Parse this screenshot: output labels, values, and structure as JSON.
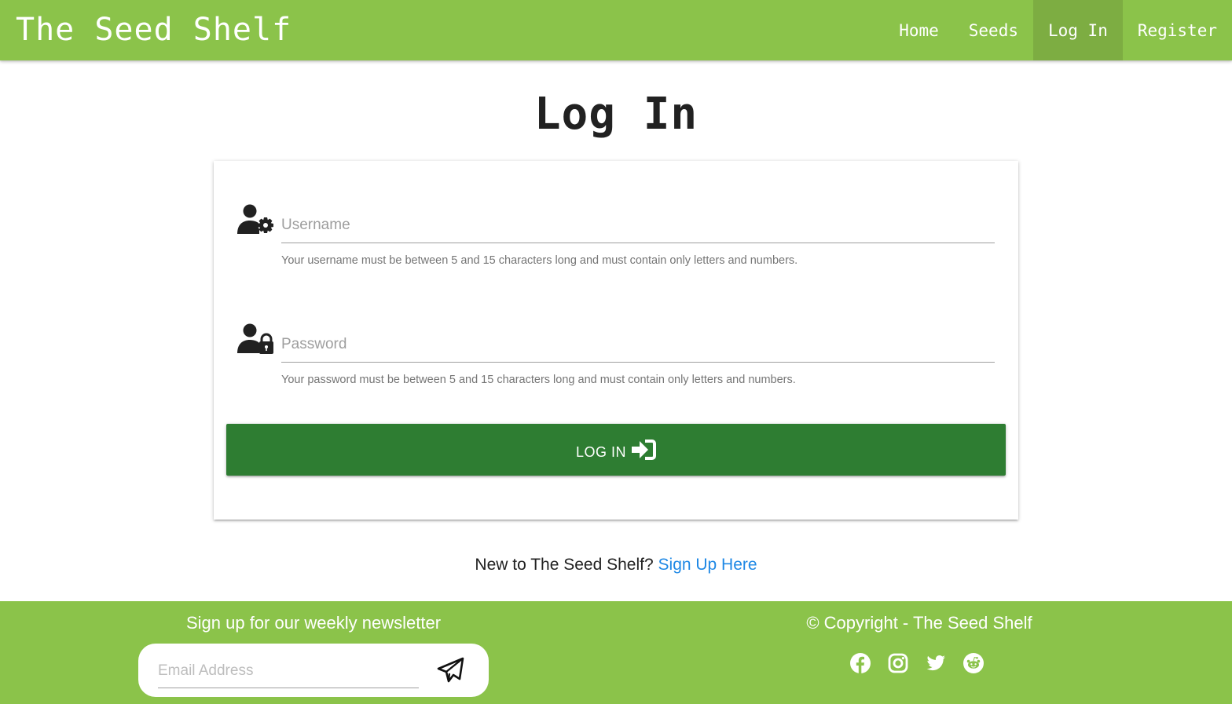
{
  "navbar": {
    "brand": "The Seed Shelf",
    "items": [
      {
        "label": "Home",
        "active": false
      },
      {
        "label": "Seeds",
        "active": false
      },
      {
        "label": "Log In",
        "active": true
      },
      {
        "label": "Register",
        "active": false
      }
    ]
  },
  "page": {
    "title": "Log In"
  },
  "form": {
    "username": {
      "icon": "user-gear-icon",
      "placeholder": "Username",
      "value": "",
      "helper": "Your username must be between 5 and 15 characters long and must contain only letters and numbers."
    },
    "password": {
      "icon": "user-lock-icon",
      "placeholder": "Password",
      "value": "",
      "helper": "Your password must be between 5 and 15 characters long and must contain only letters and numbers."
    },
    "submit_label": "LOG IN",
    "submit_icon": "sign-in-icon"
  },
  "signup": {
    "prompt": "New to The Seed Shelf?",
    "link_text": "Sign Up Here"
  },
  "footer": {
    "newsletter_title": "Sign up for our weekly newsletter",
    "email_placeholder": "Email Address",
    "send_icon": "paper-plane-icon",
    "copyright": "© Copyright - The Seed Shelf",
    "socials": [
      "facebook-icon",
      "instagram-icon",
      "twitter-icon",
      "reddit-icon"
    ]
  },
  "colors": {
    "primary_green": "#8bc34a",
    "active_nav": "#7dad42",
    "button_green": "#2e7d32",
    "link_blue": "#1e88e5"
  }
}
